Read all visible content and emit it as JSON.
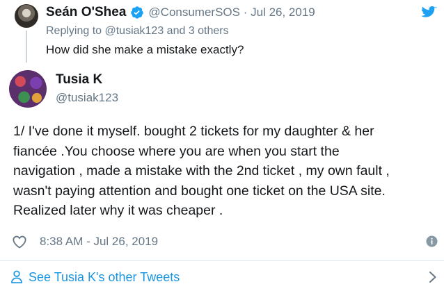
{
  "parent_tweet": {
    "author_name": "Seán O'Shea",
    "author_handle": "@ConsumerSOS",
    "separator": "·",
    "date": "Jul 26, 2019",
    "replying_to": "Replying to @tusiak123 and 3 others",
    "text": "How did she make a mistake exactly?"
  },
  "tweet": {
    "author_name": "Tusia K",
    "author_handle": "@tusiak123",
    "text_lines": [
      "1/ I've done it myself. bought 2 tickets for my daughter & her",
      "fiancée .You choose where you are when you start the",
      "navigation , made a mistake with the 2nd ticket , my own fault ,",
      "wasn't paying attention and bought one ticket on the USA site.",
      "Realized later why it was cheaper ."
    ],
    "timestamp": "8:38 AM - Jul 26, 2019"
  },
  "footer": {
    "see_more_label": "See Tusia K's other Tweets"
  },
  "icons": {
    "verified": "verified-badge-icon",
    "brand": "twitter-bird-icon",
    "like": "heart-icon",
    "info": "info-icon",
    "person": "person-icon",
    "chevron": "chevron-right-icon"
  },
  "colors": {
    "twitter_blue": "#1da1f2",
    "link_blue": "#1b95e0",
    "text": "#14171a",
    "secondary_text": "#657786",
    "divider": "#e1e8ed"
  }
}
